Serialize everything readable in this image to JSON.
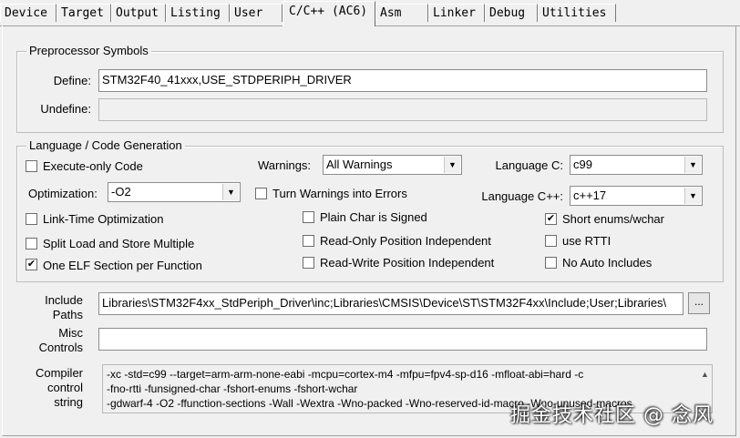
{
  "tabs": [
    {
      "label": "Device"
    },
    {
      "label": "Target"
    },
    {
      "label": "Output"
    },
    {
      "label": "Listing"
    },
    {
      "label": "User"
    },
    {
      "label": "C/C++ (AC6)"
    },
    {
      "label": "Asm"
    },
    {
      "label": "Linker"
    },
    {
      "label": "Debug"
    },
    {
      "label": "Utilities"
    }
  ],
  "preprocessor": {
    "title": "Preprocessor Symbols",
    "define_label": "Define:",
    "define_value": "STM32F40_41xxx,USE_STDPERIPH_DRIVER",
    "undefine_label": "Undefine:",
    "undefine_value": ""
  },
  "language": {
    "title": "Language / Code Generation",
    "execute_only": {
      "label": "Execute-only Code",
      "checked": false
    },
    "optimization_label": "Optimization:",
    "optimization_value": "-O2",
    "link_time": {
      "label": "Link-Time Optimization",
      "checked": false
    },
    "split_load": {
      "label": "Split Load and Store Multiple",
      "checked": false
    },
    "one_elf": {
      "label": "One ELF Section per Function",
      "checked": true
    },
    "warnings_label": "Warnings:",
    "warnings_value": "All Warnings",
    "turn_warnings": {
      "label": "Turn Warnings into Errors",
      "checked": false
    },
    "plain_char": {
      "label": "Plain Char is Signed",
      "checked": false
    },
    "read_only": {
      "label": "Read-Only Position Independent",
      "checked": false
    },
    "read_write": {
      "label": "Read-Write Position Independent",
      "checked": false
    },
    "language_c_label": "Language C:",
    "language_c_value": "c99",
    "language_cpp_label": "Language C++:",
    "language_cpp_value": "c++17",
    "short_enums": {
      "label": "Short enums/wchar",
      "checked": true
    },
    "use_rtti": {
      "label": "use RTTI",
      "checked": false
    },
    "no_auto_includes": {
      "label": "No Auto Includes",
      "checked": false
    }
  },
  "include": {
    "label_line1": "Include",
    "label_line2": "Paths",
    "value": "Libraries\\STM32F4xx_StdPeriph_Driver\\inc;Libraries\\CMSIS\\Device\\ST\\STM32F4xx\\Include;User;Libraries\\",
    "browse_label": "..."
  },
  "misc": {
    "label_line1": "Misc",
    "label_line2": "Controls",
    "value": ""
  },
  "compiler": {
    "label_line1": "Compiler",
    "label_line2": "control",
    "label_line3": "string",
    "lines": [
      "-xc -std=c99 --target=arm-arm-none-eabi -mcpu=cortex-m4 -mfpu=fpv4-sp-d16 -mfloat-abi=hard -c",
      "-fno-rtti -funsigned-char -fshort-enums -fshort-wchar",
      "-gdwarf-4 -O2 -ffunction-sections -Wall -Wextra -Wno-packed -Wno-reserved-id-macro -Wno-unused-macros"
    ]
  },
  "watermark": "掘金技术社区 @ 念风",
  "glyphs": {
    "check": "✔",
    "arrow_down": "▼",
    "arrow_up": "▲"
  }
}
